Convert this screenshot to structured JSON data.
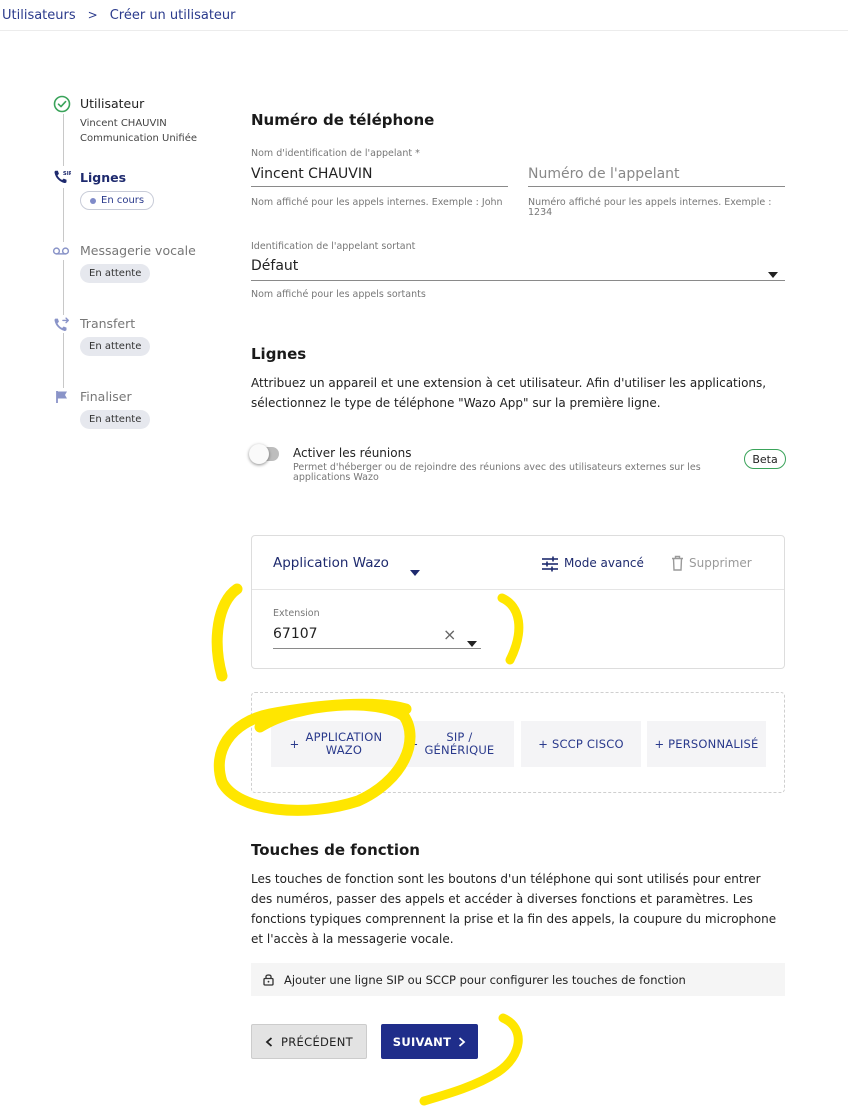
{
  "breadcrumb": {
    "parent": "Utilisateurs",
    "separator": ">",
    "current": "Créer un utilisateur"
  },
  "stepper": {
    "steps": [
      {
        "title": "Utilisateur",
        "sub1": "Vincent CHAUVIN",
        "sub2": "Communication Unifiée"
      },
      {
        "title": "Lignes",
        "status": "En cours"
      },
      {
        "title": "Messagerie vocale",
        "status": "En attente"
      },
      {
        "title": "Transfert",
        "status": "En attente"
      },
      {
        "title": "Finaliser",
        "status": "En attente"
      }
    ]
  },
  "phone": {
    "title": "Numéro de téléphone",
    "caller_name_label": "Nom d'identification de l'appelant *",
    "caller_name_value": "Vincent CHAUVIN",
    "caller_name_help": "Nom affiché pour les appels internes. Exemple : John",
    "caller_number_placeholder": "Numéro de l'appelant",
    "caller_number_help": "Numéro affiché pour les appels internes. Exemple : 1234",
    "outgoing_label": "Identification de l'appelant sortant",
    "outgoing_value": "Défaut",
    "outgoing_help": "Nom affiché pour les appels sortants"
  },
  "lines": {
    "title": "Lignes",
    "description": "Attribuez un appareil et une extension à cet utilisateur. Afin d'utiliser les applications, sélectionnez le type de téléphone \"Wazo App\" sur la première ligne.",
    "meetings_label": "Activer les réunions",
    "meetings_help": "Permet d'héberger ou de rejoindre des réunions avec des utilisateurs externes sur les applications Wazo",
    "beta_label": "Beta",
    "card": {
      "device_type": "Application Wazo",
      "advanced_mode": "Mode avancé",
      "delete": "Supprimer",
      "extension_label": "Extension",
      "extension_value": "67107",
      "clear_glyph": "×"
    },
    "add_buttons": {
      "app_plus": "+",
      "app_line1": "APPLICATION",
      "app_line2": "WAZO",
      "sip_plus": "+",
      "sip_line1": "SIP /",
      "sip_line2": "GÉNÉRIQUE",
      "sccp": "+ SCCP CISCO",
      "custom": "+ PERSONNALISÉ"
    }
  },
  "function_keys": {
    "title": "Touches de fonction",
    "description": "Les touches de fonction sont les boutons d'un téléphone qui sont utilisés pour entrer des numéros, passer des appels et accéder à diverses fonctions et paramètres. Les fonctions typiques comprennent la prise et la fin des appels, la coupure du microphone et l'accès à la messagerie vocale.",
    "info": "Ajouter une ligne SIP ou SCCP pour configurer les touches de fonction"
  },
  "nav": {
    "prev": "PRÉCÉDENT",
    "next": "SUIVANT"
  },
  "colors": {
    "accent": "#1f2d8a",
    "success": "#3aa35a",
    "annotation": "#ffe600"
  }
}
